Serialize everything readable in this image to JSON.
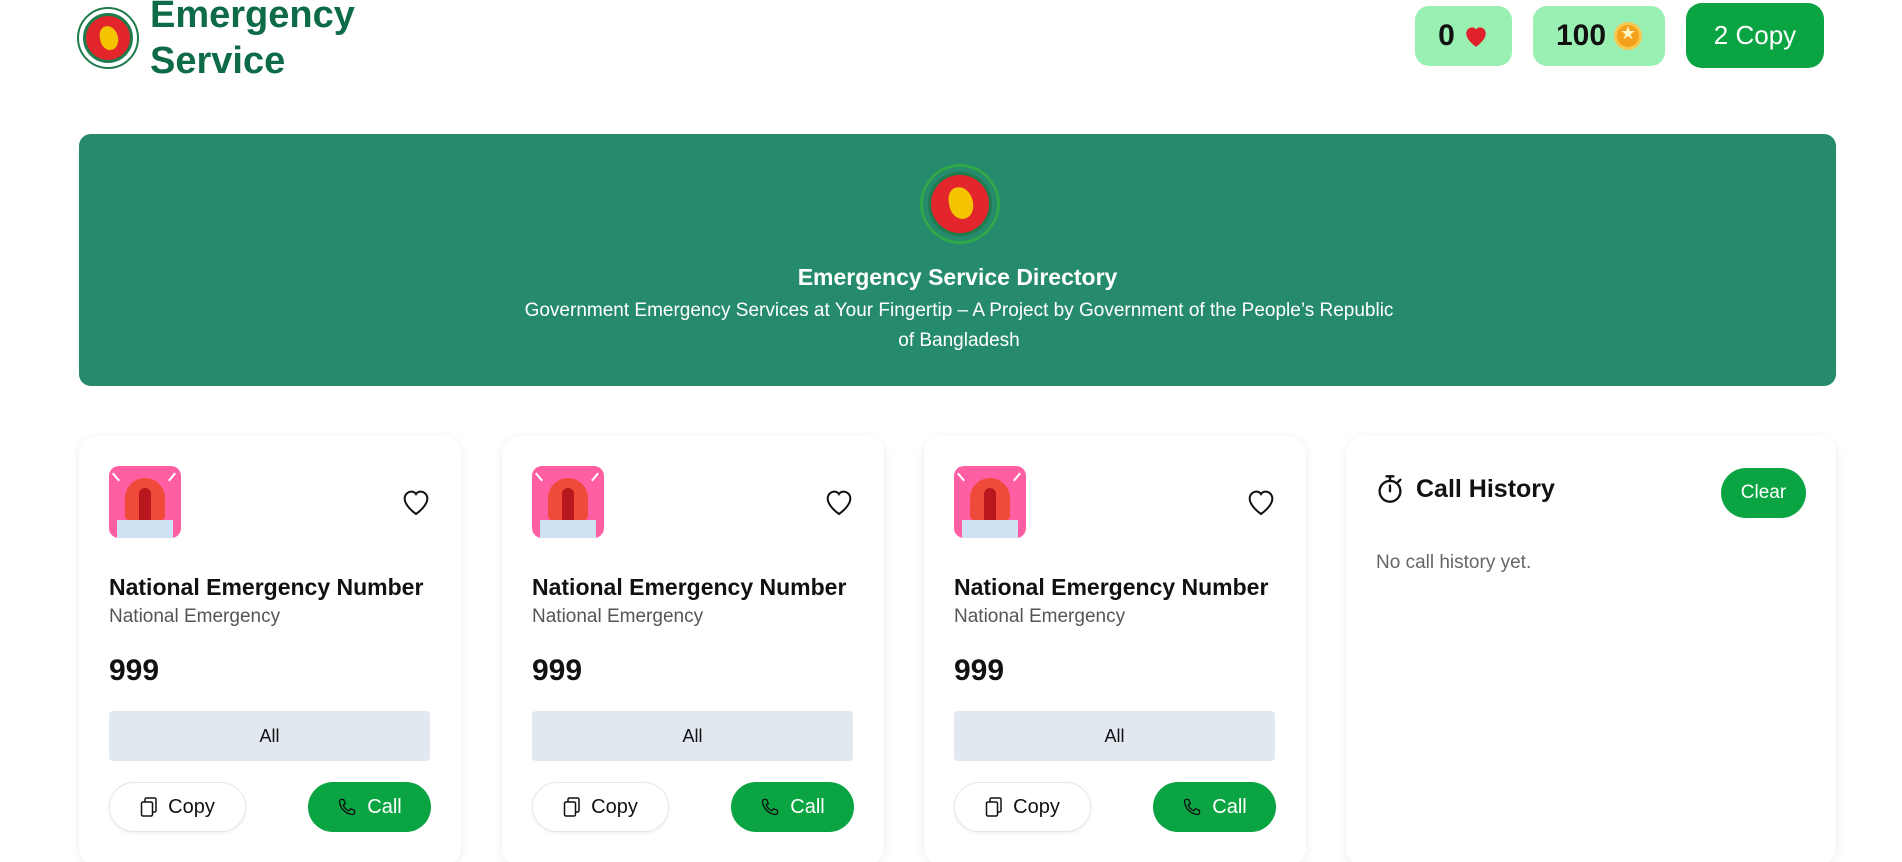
{
  "header": {
    "brand": "Emergency Service",
    "heart_count": "0",
    "coin_count": "100",
    "copy_button": "2 Copy"
  },
  "banner": {
    "title": "Emergency Service Directory",
    "subtitle": "Government Emergency Services at Your Fingertip – A Project by Government of the People’s Republic of Bangladesh"
  },
  "cards": [
    {
      "title": "National Emergency Number",
      "subtitle": "National Emergency",
      "number": "999",
      "tag": "All",
      "copy_label": "Copy",
      "call_label": "Call"
    },
    {
      "title": "National Emergency Number",
      "subtitle": "National Emergency",
      "number": "999",
      "tag": "All",
      "copy_label": "Copy",
      "call_label": "Call"
    },
    {
      "title": "National Emergency Number",
      "subtitle": "National Emergency",
      "number": "999",
      "tag": "All",
      "copy_label": "Copy",
      "call_label": "Call"
    }
  ],
  "history": {
    "title": "Call History",
    "clear_label": "Clear",
    "empty_text": "No call history yet."
  },
  "colors": {
    "brand_green": "#0e6b48",
    "banner_green": "#268b6c",
    "action_green": "#0aa443",
    "pill_green": "#9af0b2",
    "tag_gray": "#e2e8f0"
  },
  "icons": {
    "logo": "government-seal-icon",
    "heart": "heart-icon",
    "coin": "coin-icon",
    "siren": "siren-icon",
    "copy": "copy-icon",
    "call": "phone-icon",
    "history": "stopwatch-icon"
  }
}
